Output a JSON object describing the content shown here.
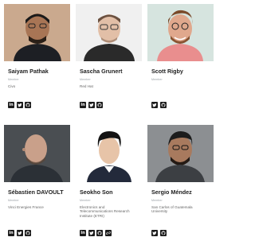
{
  "people": [
    {
      "name": "Saiyam Pathak",
      "role": "Member",
      "org": "Civo",
      "socials": [
        "linkedin-icon",
        "twitter-icon",
        "github-icon"
      ],
      "photo_bg": "#caa98e",
      "shirt": "#1d1f24",
      "skin": "#a87555"
    },
    {
      "name": "Sascha Grunert",
      "role": "Member",
      "org": "Red Hat",
      "socials": [
        "linkedin-icon",
        "twitter-icon",
        "github-icon"
      ],
      "photo_bg": "#f0f0f0",
      "shirt": "#2a2a2a",
      "skin": "#e2bfa7"
    },
    {
      "name": "Scott Rigby",
      "role": "Member",
      "org": "",
      "socials": [
        "twitter-icon",
        "github-icon"
      ],
      "photo_bg": "#d6e4df",
      "shirt": "#e98e8e",
      "skin": "#e0a88d"
    },
    {
      "name": "Sébastien DAVOULT",
      "role": "Member",
      "org": "Vinci Energies France",
      "socials": [
        "linkedin-icon",
        "twitter-icon",
        "github-icon"
      ],
      "photo_bg": "#4a4e52",
      "shirt": "#2b3036",
      "skin": "#c9a08a"
    },
    {
      "name": "Seokho Son",
      "role": "Member",
      "org": "Electronics and Telecommunications Research Institute (ETRI)",
      "socials": [
        "linkedin-icon",
        "twitter-icon",
        "github-icon",
        "link-icon"
      ],
      "photo_bg": "#ffffff",
      "shirt": "#232a3b",
      "skin": "#e7c4a8"
    },
    {
      "name": "Sergio Méndez",
      "role": "Member",
      "org": "San Carlos of Guatemala University",
      "socials": [
        "twitter-icon",
        "github-icon"
      ],
      "photo_bg": "#8c8f92",
      "shirt": "#3c3f43",
      "skin": "#a87a5e"
    }
  ]
}
